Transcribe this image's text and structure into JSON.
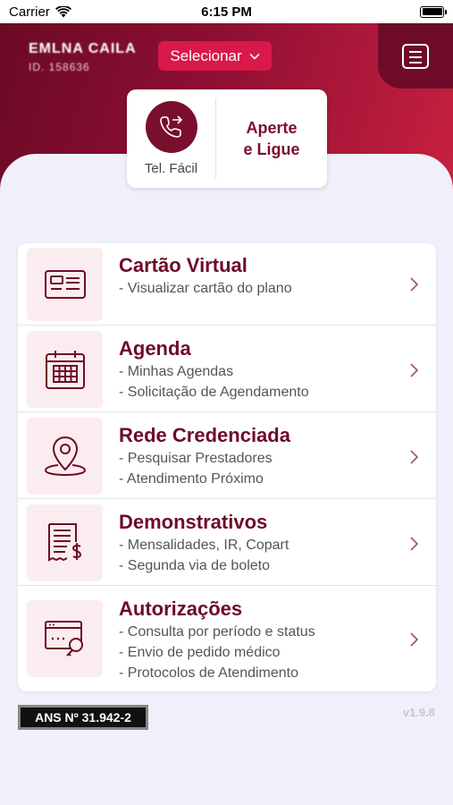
{
  "status_bar": {
    "carrier": "Carrier",
    "time": "6:15 PM"
  },
  "header": {
    "user_name": "EMLNA CAILA",
    "user_card": "ID. 158636",
    "select_label": "Selecionar",
    "brand_color": "#8e0f33"
  },
  "quick_access": {
    "tel_facil_label": "Tel. Fácil",
    "aperte_line1": "Aperte",
    "aperte_line2": "e Ligue"
  },
  "menu": {
    "items": [
      {
        "title": "Cartão Virtual",
        "icon": "id-card-icon",
        "lines": [
          "- Visualizar cartão do plano"
        ]
      },
      {
        "title": "Agenda",
        "icon": "calendar-icon",
        "lines": [
          "- Minhas Agendas",
          "- Solicitação de Agendamento"
        ]
      },
      {
        "title": "Rede Credenciada",
        "icon": "map-pin-icon",
        "lines": [
          "- Pesquisar Prestadores",
          "- Atendimento Próximo"
        ]
      },
      {
        "title": "Demonstrativos",
        "icon": "invoice-icon",
        "lines": [
          "- Mensalidades, IR, Copart",
          "- Segunda via de boleto"
        ]
      },
      {
        "title": "Autorizações",
        "icon": "authorization-icon",
        "lines": [
          "- Consulta por período e status",
          "- Envio de pedido médico",
          "- Protocolos de Atendimento"
        ]
      }
    ]
  },
  "footer": {
    "ans": "ANS  Nº 31.942-2",
    "version": "v1.9.8"
  }
}
